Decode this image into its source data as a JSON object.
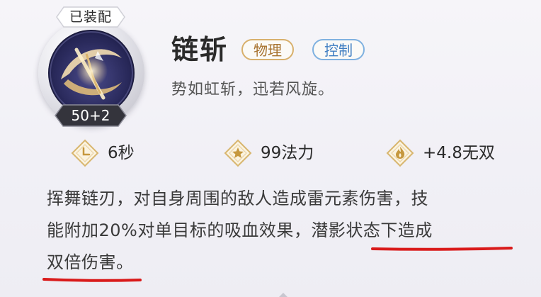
{
  "skill": {
    "equipped_label": "已装配",
    "level_label": "50+2",
    "icon": "chain-blade-skill-icon",
    "name": "链斩",
    "tags": [
      {
        "label": "物理",
        "color": "#a7722e"
      },
      {
        "label": "控制",
        "color": "#3f7ec2"
      }
    ],
    "subtitle": "势如虹斩，迅若风旋。"
  },
  "stats": [
    {
      "icon": "clock-icon",
      "value": "6秒"
    },
    {
      "icon": "star-icon",
      "value": "99法力"
    },
    {
      "icon": "flame-icon",
      "value": "+4.8无双"
    }
  ],
  "description": {
    "line1": "挥舞链刃，对自身周围的敌人造成雷元素伤害，技",
    "line2_plain": "能附加20%对单目标的吸血效果，",
    "line2_highlight": "潜影状态下造成",
    "line3_highlight": "双倍伤害",
    "line3_plain": "。",
    "highlight_color": "#d91a1a"
  }
}
